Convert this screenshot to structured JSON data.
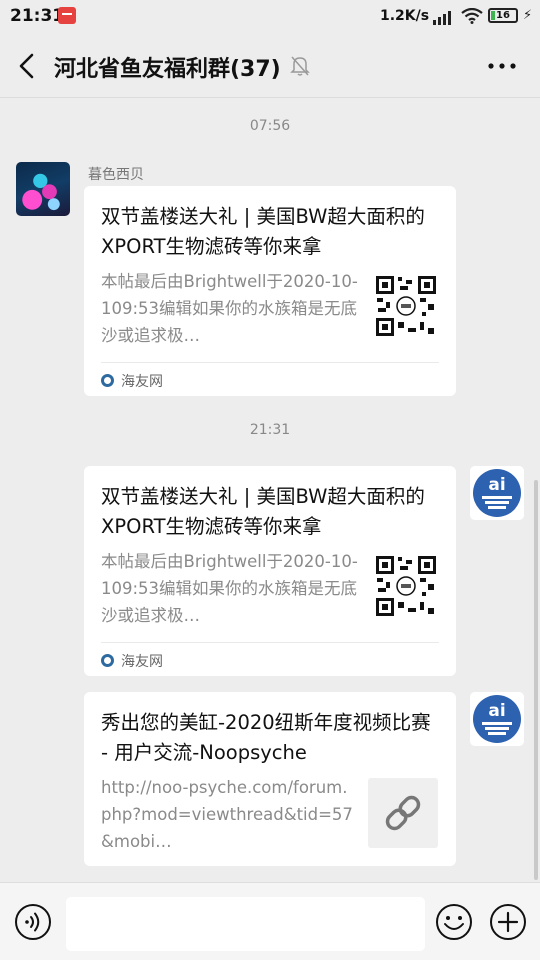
{
  "status_bar": {
    "time": "21:31",
    "net_speed": "1.2K/s",
    "battery_level": "16",
    "battery_color": "#3fb34f"
  },
  "nav": {
    "title": "河北省鱼友福利群(37)",
    "back_icon": "chevron-left-icon",
    "mute_icon": "bell-off-icon",
    "more_icon": "more-dots-icon"
  },
  "messages": [
    {
      "timestamp": "07:56",
      "sender": "暮色西贝",
      "side": "left",
      "type": "article",
      "title": "双节盖楼送大礼 | 美国BW超大面积的XPORT生物滤砖等你来拿",
      "desc": "本帖最后由Brightwell于2020-10-109:53编辑如果你的水族箱是无底沙或追求极…",
      "source": "海友网"
    },
    {
      "timestamp": "21:31",
      "side": "right",
      "type": "article",
      "title": "双节盖楼送大礼 | 美国BW超大面积的XPORT生物滤砖等你来拿",
      "desc": "本帖最后由Brightwell于2020-10-109:53编辑如果你的水族箱是无底沙或追求极…",
      "source": "海友网"
    },
    {
      "side": "right",
      "type": "link",
      "title": "秀出您的美缸-2020纽斯年度视频比赛 - 用户交流-Noopsyche",
      "desc": "http://noo-psyche.com/forum.php?mod=viewthread&tid=57&mobi…"
    }
  ],
  "input_bar": {
    "voice_icon": "voice-icon",
    "emoji_icon": "emoji-icon",
    "plus_icon": "plus-icon"
  },
  "colors": {
    "background": "#ededed",
    "bubble": "#ffffff",
    "accent_link_icon": "#2d6aa0"
  }
}
